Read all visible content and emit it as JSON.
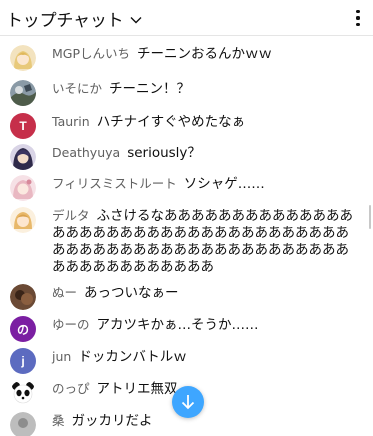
{
  "header": {
    "title": "トップチャット",
    "mode_icon": "chevron-down-icon",
    "menu_icon": "more-vert-icon"
  },
  "messages": [
    {
      "author": "MGPしんいち",
      "text": "チーニンおるんかｗｗ",
      "avatar_type": "image",
      "avatar_color": "#e8c97a"
    },
    {
      "author": "いそにか",
      "text": "チーニン！？",
      "avatar_type": "image",
      "avatar_color": "#6d7b8a"
    },
    {
      "author": "Taurin",
      "text": "ハチナイすぐやめたなぁ",
      "avatar_type": "letter",
      "avatar_letter": "T",
      "avatar_color": "#c62f4a"
    },
    {
      "author": "Deathyuya",
      "text": "seriously？",
      "avatar_type": "image",
      "avatar_color": "#4a3f6b"
    },
    {
      "author": "フィリスミストルート",
      "text": "ソシャゲ……",
      "avatar_type": "image",
      "avatar_color": "#e9b8c2"
    },
    {
      "author": "デルタ",
      "text": "ふさけるなああああああああああああああああああああああああああああああああああああああああああああああああああああああああああああああああああああああ",
      "avatar_type": "image",
      "avatar_color": "#f0d3a8"
    },
    {
      "author": "ぬー",
      "text": "あっついなぁー",
      "avatar_type": "image",
      "avatar_color": "#5a3b2a"
    },
    {
      "author": "ゆーの",
      "text": "アカツキかぁ…そうか……",
      "avatar_type": "letter",
      "avatar_letter": "の",
      "avatar_color": "#7b1fa2"
    },
    {
      "author": "jun",
      "text": "ドッカンバトルｗ",
      "avatar_type": "letter",
      "avatar_letter": "j",
      "avatar_color": "#5c6bc0"
    },
    {
      "author": "のっぴ",
      "text": "アトリエ無双",
      "avatar_type": "image",
      "avatar_color": "#ffffff"
    },
    {
      "author": "桑",
      "text": "ガッカリだよ",
      "avatar_type": "image",
      "avatar_color": "#9e9e9e"
    }
  ],
  "scroll_down_icon": "arrow-down-icon",
  "colors": {
    "accent": "#3ea6ff",
    "author": "#606060",
    "text": "#0f0f0f"
  }
}
